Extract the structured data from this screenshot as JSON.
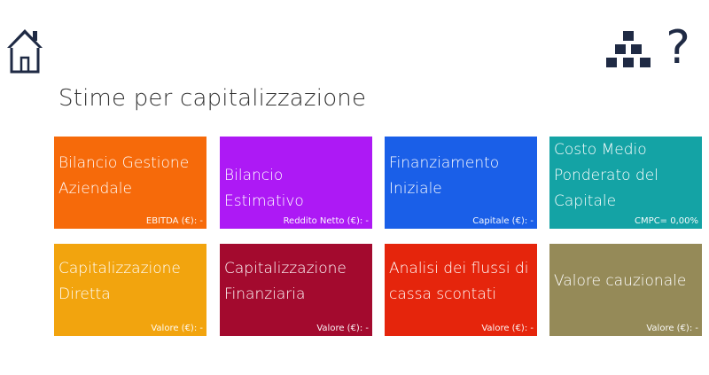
{
  "header": {
    "home_icon": "home-icon",
    "sitemap_icon": "sitemap-icon",
    "help_label": "?"
  },
  "page": {
    "title": "Stime per capitalizzazione"
  },
  "tiles": [
    {
      "name_lines": [
        "Bilancio Gestione",
        "Aziendale"
      ],
      "meta": "EBITDA (€): -",
      "color": "#f66a0a"
    },
    {
      "name_lines": [
        "Bilancio Estimativo"
      ],
      "meta": "Reddito Netto (€): -",
      "color": "#ad19f5"
    },
    {
      "name_lines": [
        "Finanziamento",
        "Iniziale"
      ],
      "meta": "Capitale (€): -",
      "color": "#1a5fe8"
    },
    {
      "name_lines": [
        "Costo Medio",
        "Ponderato del",
        "Capitale"
      ],
      "meta": "CMPC= 0,00%",
      "color": "#14a3a5"
    },
    {
      "name_lines": [
        "Capitalizzazione",
        "Diretta"
      ],
      "meta": "Valore (€): -",
      "color": "#f2a40e"
    },
    {
      "name_lines": [
        "Capitalizzazione",
        "Finanziaria"
      ],
      "meta": "Valore (€): -",
      "color": "#a30a2e"
    },
    {
      "name_lines": [
        "Analisi dei flussi di",
        "cassa scontati"
      ],
      "meta": "Valore (€): -",
      "color": "#e5250c"
    },
    {
      "name_lines": [
        "Valore cauzionale"
      ],
      "meta": "Valore (€): -",
      "color": "#958a58"
    }
  ]
}
